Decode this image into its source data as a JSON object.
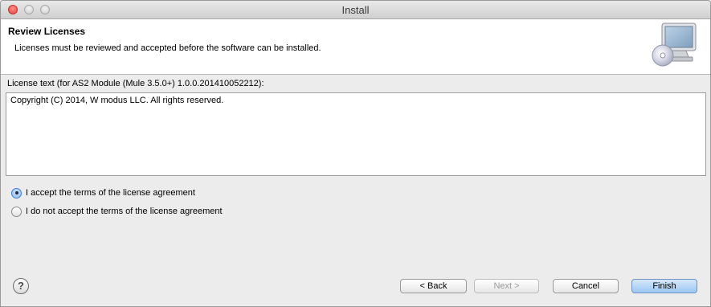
{
  "window": {
    "title": "Install"
  },
  "header": {
    "title": "Review Licenses",
    "description": "Licenses must be reviewed and accepted before the software can be installed.",
    "icon": "install-computer-cd-icon"
  },
  "license": {
    "label": "License text (for AS2 Module (Mule 3.5.0+) 1.0.0.201410052212):",
    "text": "Copyright (C) 2014, W modus LLC. All rights reserved."
  },
  "options": {
    "accept": {
      "label": "I accept the terms of the license agreement",
      "selected": true
    },
    "decline": {
      "label": "I do not accept the terms of the license agreement",
      "selected": false
    }
  },
  "footer": {
    "help_symbol": "?",
    "back_label": "< Back",
    "next_label": "Next >",
    "cancel_label": "Cancel",
    "finish_label": "Finish"
  }
}
